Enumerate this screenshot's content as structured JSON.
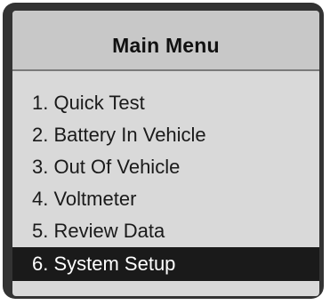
{
  "menu": {
    "title": "Main Menu",
    "items": [
      {
        "label": "1. Quick Test"
      },
      {
        "label": "2. Battery In Vehicle"
      },
      {
        "label": "3. Out Of Vehicle"
      },
      {
        "label": "4. Voltmeter"
      },
      {
        "label": "5. Review Data"
      },
      {
        "label": "6. System Setup"
      }
    ],
    "selected_label": "6. System Setup"
  },
  "colors": {
    "screen_background": "#d9d9d9",
    "title_background": "#c8c8c8",
    "frame": "#333333",
    "selection_background": "#1a1a1a",
    "selection_text": "#ffffff",
    "text": "#1a1a1a"
  }
}
